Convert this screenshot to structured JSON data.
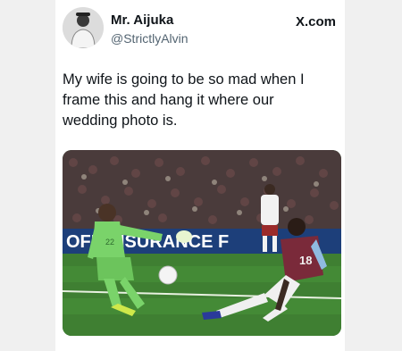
{
  "author": {
    "name": "Mr. Aijuka",
    "handle": "@StrictlyAlvin"
  },
  "brand": "X.com",
  "tweet": {
    "text_lines": [
      "My wife is going to be so mad when I",
      "frame this and hang it where our",
      "wedding photo is."
    ]
  },
  "media": {
    "board_text": "OFF    INSURANCE F",
    "goalkeeper_shirt_number": "22",
    "player_shirt_number": "18"
  },
  "icons": {
    "brand": "x-logo-icon",
    "avatar": "profile-photo-icon"
  },
  "colors": {
    "text_primary": "#0f1419",
    "text_secondary": "#536471",
    "pitch": "#3f7f32",
    "keeper_kit": "#7ad36a",
    "away_kit": "#7a2a3a"
  }
}
